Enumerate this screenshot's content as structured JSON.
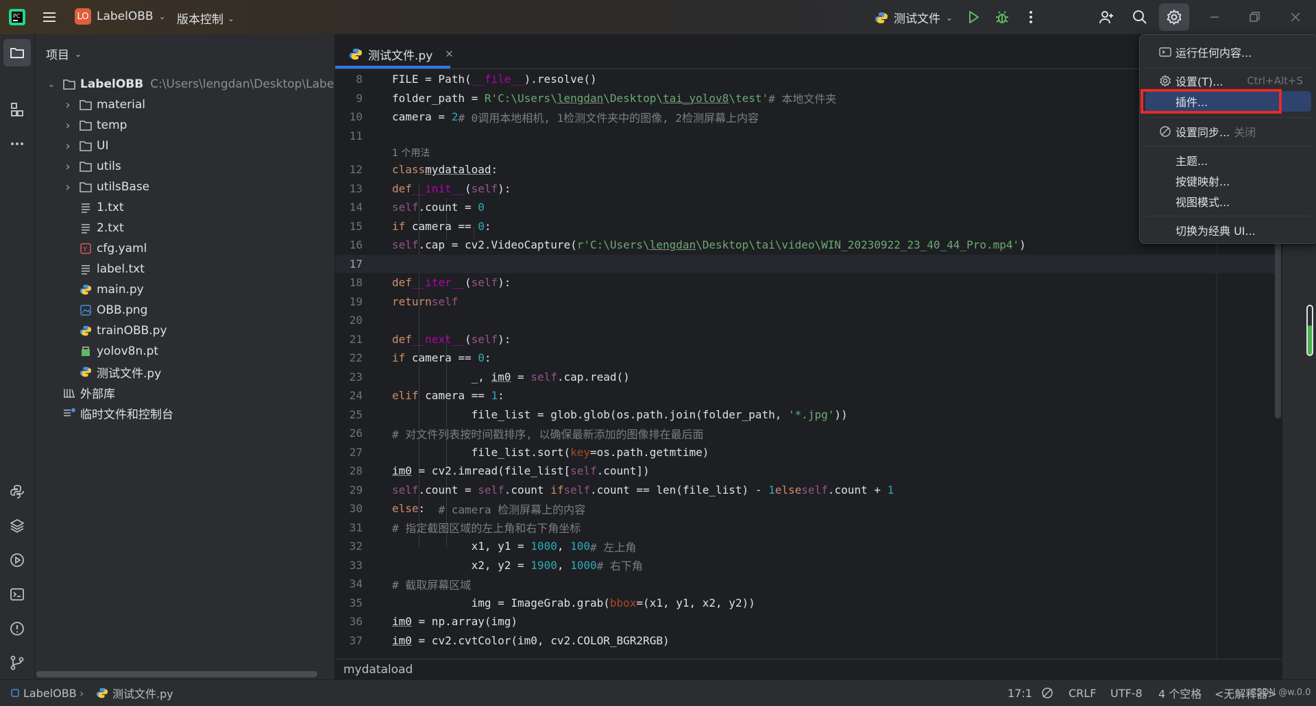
{
  "titlebar": {
    "project_badge": "LO",
    "project_name": "LabelOBB",
    "vcs_label": "版本控制",
    "run_config": "测试文件"
  },
  "colors": {
    "accent": "#3574f0",
    "selection": "#2e436e",
    "highlight_box": "#e52b2b",
    "badge": "#e05d3a"
  },
  "project_panel": {
    "title": "项目",
    "root": {
      "name": "LabelOBB",
      "path": "C:\\Users\\lengdan\\Desktop\\LabelOBB"
    },
    "items": [
      {
        "name": "material",
        "type": "folder"
      },
      {
        "name": "temp",
        "type": "folder"
      },
      {
        "name": "UI",
        "type": "folder"
      },
      {
        "name": "utils",
        "type": "folder"
      },
      {
        "name": "utilsBase",
        "type": "folder"
      },
      {
        "name": "1.txt",
        "type": "text"
      },
      {
        "name": "2.txt",
        "type": "text"
      },
      {
        "name": "cfg.yaml",
        "type": "yaml"
      },
      {
        "name": "label.txt",
        "type": "text"
      },
      {
        "name": "main.py",
        "type": "python"
      },
      {
        "name": "OBB.png",
        "type": "image"
      },
      {
        "name": "trainOBB.py",
        "type": "python"
      },
      {
        "name": "yolov8n.pt",
        "type": "binary"
      },
      {
        "name": "测试文件.py",
        "type": "python"
      }
    ],
    "external_libs": "外部库",
    "scratches": "临时文件和控制台"
  },
  "editor": {
    "tab_label": "测试文件.py",
    "usage_hint": "1 个用法",
    "breadcrumb": "mydataload",
    "line_numbers": [
      "8",
      "9",
      "10",
      "11",
      "12",
      "13",
      "14",
      "15",
      "16",
      "17",
      "18",
      "19",
      "20",
      "21",
      "22",
      "23",
      "24",
      "25",
      "26",
      "27",
      "28",
      "29",
      "30",
      "31",
      "32",
      "33",
      "34",
      "35",
      "36",
      "37"
    ],
    "current_line": "17"
  },
  "menu": {
    "items": [
      {
        "label": "运行任何内容...",
        "icon": "run-anything-icon"
      },
      {
        "label": "设置(T)...",
        "shortcut": "Ctrl+Alt+S",
        "icon": "gear-icon"
      },
      {
        "label": "插件...",
        "selected": true
      },
      {
        "label": "设置同步...",
        "state": "关闭",
        "icon": "sync-off-icon"
      },
      {
        "label": "主题..."
      },
      {
        "label": "按键映射..."
      },
      {
        "label": "视图模式..."
      },
      {
        "label": "切换为经典 UI..."
      }
    ]
  },
  "statusbar": {
    "project": "LabelOBB",
    "file": "测试文件.py",
    "position": "17:1",
    "line_sep": "CRLF",
    "encoding": "UTF-8",
    "indent": "4 个空格",
    "interpreter": "<无解释器>",
    "watermark": "CSDN @w.0.0"
  }
}
